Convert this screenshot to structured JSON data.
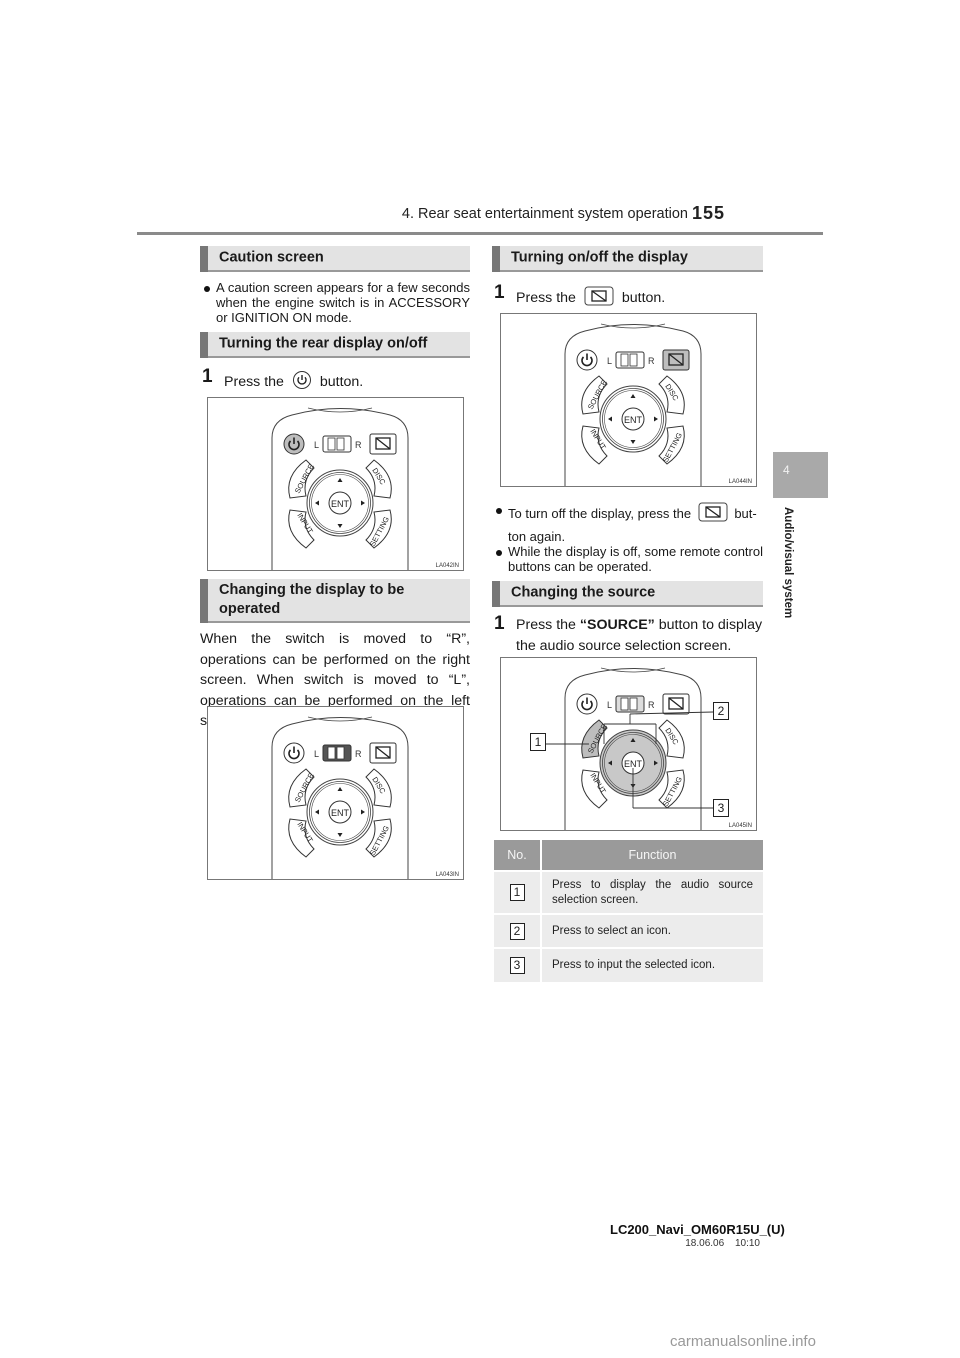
{
  "header": {
    "chapter_title": "4. Rear seat entertainment system operation",
    "page_number": "155"
  },
  "side_tab": {
    "number": "4",
    "label": "Audio/visual system"
  },
  "left_column": {
    "caution": {
      "heading": "Caution screen",
      "bullet": "A caution screen appears for a few seconds when the engine switch is in ACCESSORY or IGNITION ON mode."
    },
    "rear_display": {
      "heading": "Turning the rear display on/off",
      "step_number": "1",
      "step_before": "Press the",
      "step_icon": "power-icon",
      "step_after": "button.",
      "figure_code": "LA042IN"
    },
    "change_display": {
      "heading_line1": "Changing the display to be",
      "heading_line2": "operated",
      "body": "When the switch is moved to “R”, operations can be performed on the right screen. When switch is moved to “L”, operations can be performed on the left screen.",
      "figure_code": "LA043IN"
    }
  },
  "right_column": {
    "display_onoff": {
      "heading": "Turning on/off the display",
      "step_number": "1",
      "step_before": "Press the",
      "step_icon": "display-off-icon",
      "step_after": "button.",
      "figure_code": "LA044IN",
      "bullets": [
        {
          "before": "To turn off the display, press the",
          "icon": "display-off-icon",
          "after": "but-",
          "line2": "ton again."
        },
        {
          "text": "While the display is off, some remote control buttons can be operated."
        }
      ]
    },
    "change_source": {
      "heading": "Changing the source",
      "step_number": "1",
      "step_before": "Press the",
      "step_bold": "“SOURCE”",
      "step_after": "button to display",
      "step_line2": "the audio source selection screen.",
      "figure_code": "LA045IN",
      "callouts": [
        "1",
        "2",
        "3"
      ]
    },
    "table": {
      "columns": [
        "No.",
        "Function"
      ],
      "rows": [
        {
          "no": "1",
          "function": "Press to display the audio source selection screen."
        },
        {
          "no": "2",
          "function": "Press to select an icon."
        },
        {
          "no": "3",
          "function": "Press to input the selected icon."
        }
      ]
    }
  },
  "remote": {
    "switch_left": "L",
    "switch_right": "R",
    "buttons": [
      "SOURCE",
      "DISC",
      "INPUT",
      "SETTING",
      "ENT"
    ]
  },
  "footer": {
    "model": "LC200_Navi_OM60R15U_(U)",
    "date": "18.06.06",
    "time": "10:10"
  },
  "watermark": "carmanualsonline.info"
}
